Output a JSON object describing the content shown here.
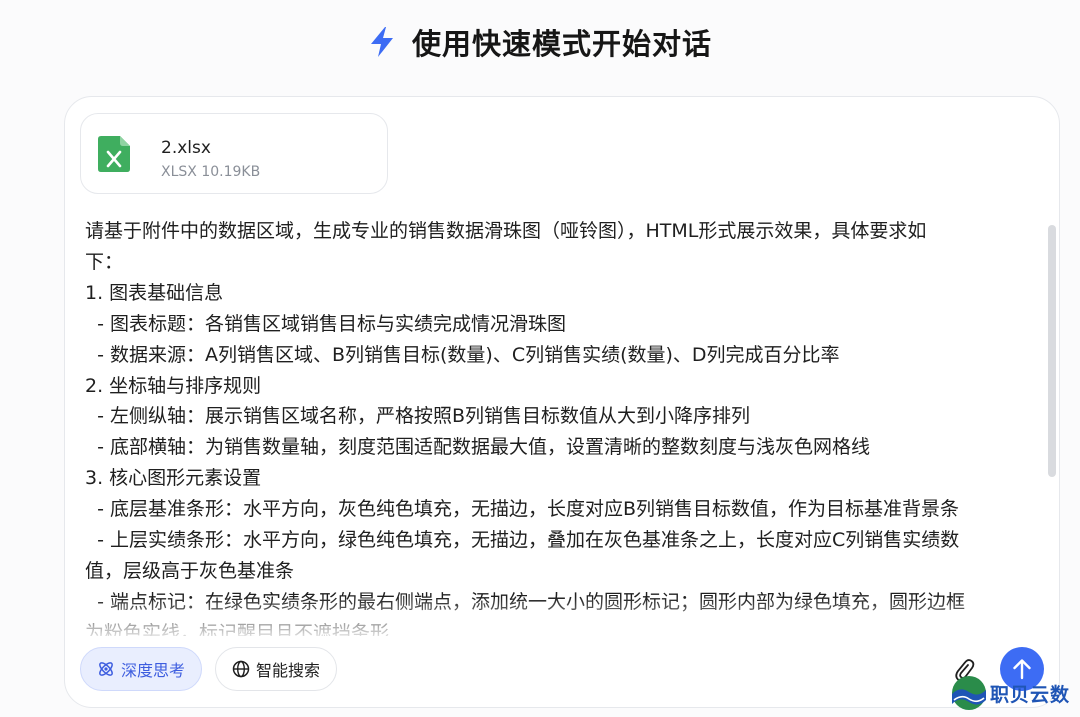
{
  "header": {
    "title": "使用快速模式开始对话",
    "icon": "lightning-bolt-icon",
    "accent_color": "#3d6cf4"
  },
  "attachment": {
    "file_name": "2.xlsx",
    "file_meta": "XLSX 10.19KB",
    "icon": "excel-file-icon",
    "icon_color": "#3fae5f"
  },
  "message": {
    "lines": [
      "请基于附件中的数据区域，生成专业的销售数据滑珠图（哑铃图），HTML形式展示效果，具体要求如",
      "下：",
      "1. 图表基础信息",
      "  - 图表标题：各销售区域销售目标与实绩完成情况滑珠图",
      "  - 数据来源：A列销售区域、B列销售目标(数量)、C列销售实绩(数量)、D列完成百分比率",
      "2. 坐标轴与排序规则",
      "  - 左侧纵轴：展示销售区域名称，严格按照B列销售目标数值从大到小降序排列",
      "  - 底部横轴：为销售数量轴，刻度范围适配数据最大值，设置清晰的整数刻度与浅灰色网格线",
      "3. 核心图形元素设置",
      "  - 底层基准条形：水平方向，灰色纯色填充，无描边，长度对应B列销售目标数值，作为目标基准背景条",
      "  - 上层实绩条形：水平方向，绿色纯色填充，无描边，叠加在灰色基准条之上，长度对应C列销售实绩数",
      "值，层级高于灰色基准条",
      "  - 端点标记：在绿色实绩条形的最右侧端点，添加统一大小的圆形标记；圆形内部为绿色填充，圆形边框",
      "为粉色实线，标记醒目且不遮挡条形"
    ]
  },
  "toolbar": {
    "deep_think_label": "深度思考",
    "deep_think_icon": "atom-icon",
    "web_search_label": "智能搜索",
    "web_search_icon": "globe-icon",
    "attach_icon": "paperclip-icon",
    "send_icon": "arrow-up-icon"
  },
  "watermark": {
    "text": "职贝云数",
    "icon": "wave-logo-icon"
  }
}
